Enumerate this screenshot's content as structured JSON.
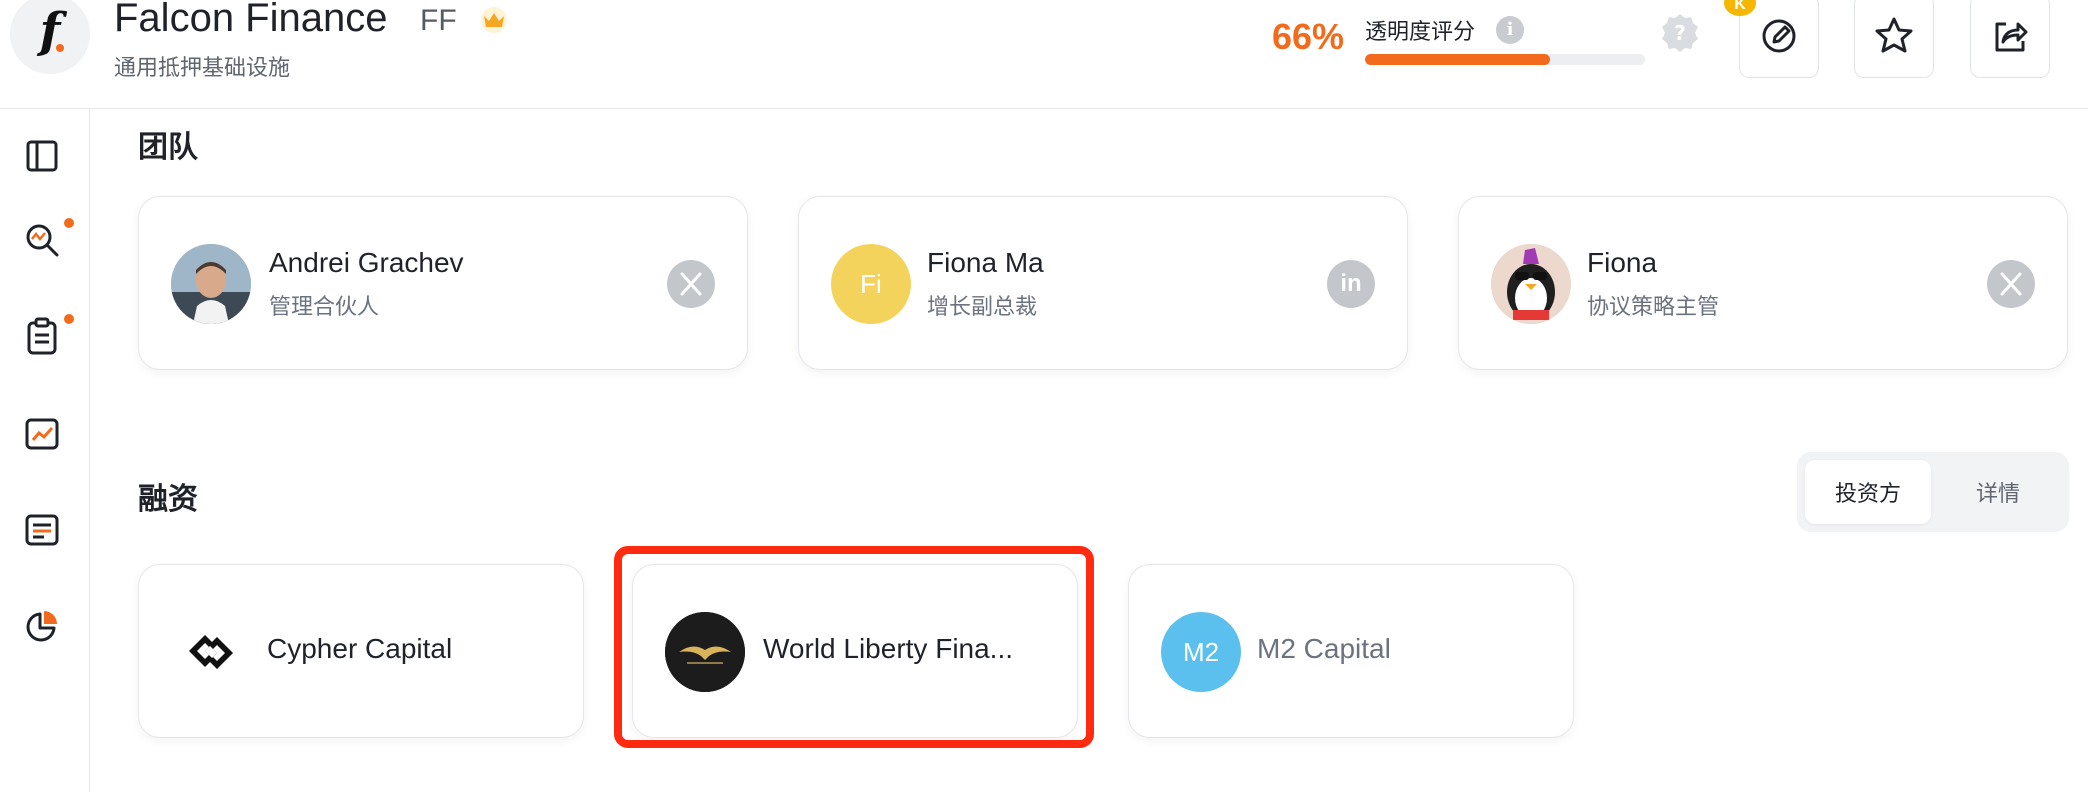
{
  "header": {
    "project_name": "Falcon Finance",
    "symbol": "FF",
    "subtitle": "通用抵押基础设施",
    "transparency_score": "66%",
    "transparency_label": "透明度评分",
    "transparency_progress": 0.66,
    "badge_letter": "K",
    "icons": [
      "edit-icon",
      "star-icon",
      "share-icon"
    ]
  },
  "sidebar": {
    "items": [
      {
        "icon": "panel-toggle-icon"
      },
      {
        "icon": "analysis-search-icon",
        "dot": true
      },
      {
        "icon": "clipboard-icon",
        "dot": true
      },
      {
        "icon": "trend-chart-icon"
      },
      {
        "icon": "document-list-icon"
      },
      {
        "icon": "pie-chart-icon"
      }
    ]
  },
  "team": {
    "title": "团队",
    "members": [
      {
        "name": "Andrei Grachev",
        "role": "管理合伙人",
        "social": "x-icon"
      },
      {
        "name": "Fiona Ma",
        "role": "增长副总裁",
        "initials": "Fi",
        "social": "linkedin-icon"
      },
      {
        "name": "Fiona",
        "role": "协议策略主管",
        "social": "x-icon"
      }
    ]
  },
  "funding": {
    "title": "融资",
    "tabs": {
      "investors": "投资方",
      "details": "详情"
    },
    "investors": [
      {
        "name": "Cypher Capital"
      },
      {
        "name": "World Liberty Fina..."
      },
      {
        "name": "M2 Capital",
        "initials": "M2"
      }
    ]
  },
  "colors": {
    "accent": "#f26b1d",
    "highlight": "#ff2a10",
    "social_gray": "#c3c6cb",
    "m2_blue": "#5bc0ee",
    "fi_yellow": "#f3d35b"
  }
}
